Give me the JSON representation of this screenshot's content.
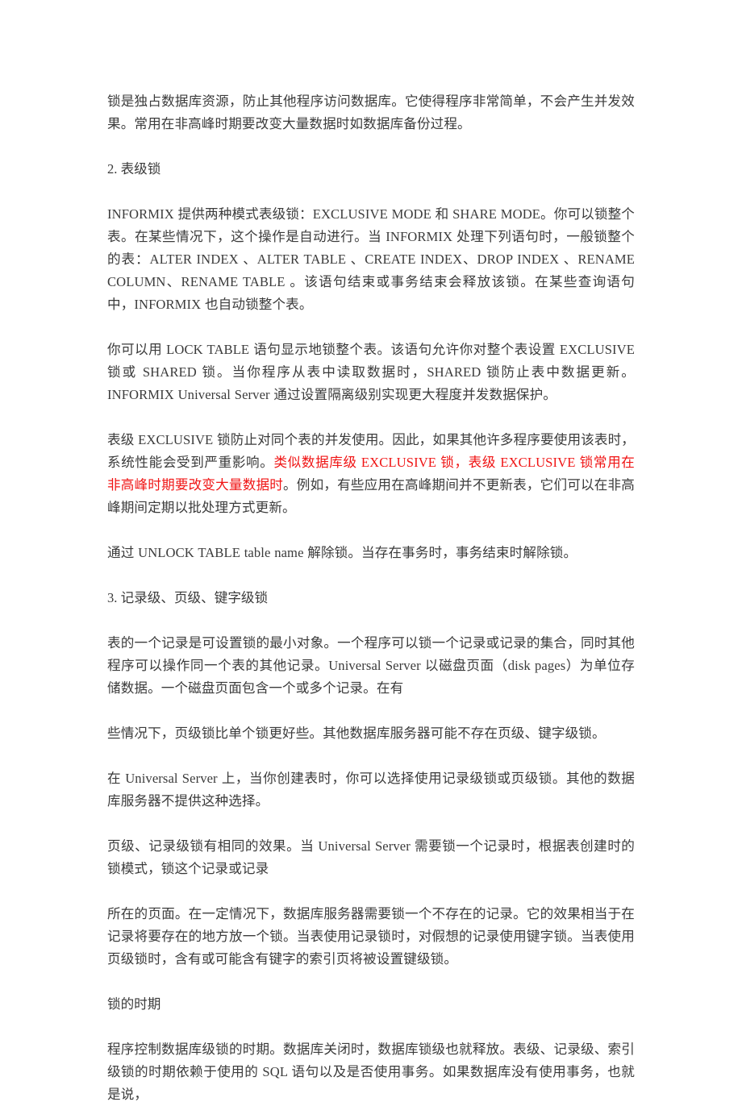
{
  "document": {
    "text_color": "#3b3b3b",
    "highlight_color": "#f01414",
    "background_color": "#ffffff",
    "blocks": [
      {
        "id": "p1",
        "type": "paragraph",
        "text": "锁是独占数据库资源，防止其他程序访问数据库。它使得程序非常简单，不会产生并发效果。常用在非高峰时期要改变大量数据时如数据库备份过程。"
      },
      {
        "id": "h2",
        "type": "heading",
        "text": "2. 表级锁"
      },
      {
        "id": "p2",
        "type": "paragraph",
        "text": "INFORMIX 提供两种模式表级锁：EXCLUSIVE MODE  和 SHARE MODE。你可以锁整个表。在某些情况下，这个操作是自动进行。当 INFORMIX 处理下列语句时，一般锁整个的表：ALTER INDEX 、ALTER TABLE 、CREATE INDEX、DROP INDEX 、RENAME COLUMN、RENAME TABLE 。该语句结束或事务结束会释放该锁。在某些查询语句中，INFORMIX 也自动锁整个表。"
      },
      {
        "id": "p3",
        "type": "paragraph",
        "text": "你可以用 LOCK TABLE 语句显示地锁整个表。该语句允许你对整个表设置 EXCLUSIVE 锁或 SHARED 锁。当你程序从表中读取数据时，SHARED 锁防止表中数据更新。INFORMIX Universal Server  通过设置隔离级别实现更大程度并发数据保护。"
      },
      {
        "id": "p4",
        "type": "paragraph-mixed",
        "text_before": "表级 EXCLUSIVE 锁防止对同个表的并发使用。因此，如果其他许多程序要使用该表时，系统性能会受到严重影响。",
        "text_highlight": "类似数据库级 EXCLUSIVE  锁，表级 EXCLUSIVE 锁常用在非高峰时期要改变大量数据时",
        "text_after": "。例如，有些应用在高峰期间并不更新表，它们可以在非高峰期间定期以批处理方式更新。"
      },
      {
        "id": "p5",
        "type": "paragraph",
        "text": "通过 UNLOCK TABLE table name  解除锁。当存在事务时，事务结束时解除锁。"
      },
      {
        "id": "h3",
        "type": "heading",
        "text": "3. 记录级、页级、键字级锁"
      },
      {
        "id": "p6",
        "type": "paragraph",
        "text": "表的一个记录是可设置锁的最小对象。一个程序可以锁一个记录或记录的集合，同时其他程序可以操作同一个表的其他记录。Universal Server  以磁盘页面（disk pages）为单位存储数据。一个磁盘页面包含一个或多个记录。在有"
      },
      {
        "id": "p7",
        "type": "paragraph",
        "text": "些情况下，页级锁比单个锁更好些。其他数据库服务器可能不存在页级、键字级锁。"
      },
      {
        "id": "p8",
        "type": "paragraph",
        "text": "在 Universal Server 上，当你创建表时，你可以选择使用记录级锁或页级锁。其他的数据库服务器不提供这种选择。"
      },
      {
        "id": "p9",
        "type": "paragraph",
        "text": "页级、记录级锁有相同的效果。当 Universal Server 需要锁一个记录时，根据表创建时的锁模式，锁这个记录或记录"
      },
      {
        "id": "p10",
        "type": "paragraph",
        "text": "所在的页面。在一定情况下，数据库服务器需要锁一个不存在的记录。它的效果相当于在记录将要存在的地方放一个锁。当表使用记录锁时，对假想的记录使用键字锁。当表使用页级锁时，含有或可能含有键字的索引页将被设置键级锁。"
      },
      {
        "id": "h4",
        "type": "heading",
        "text": "锁的时期"
      },
      {
        "id": "p11",
        "type": "paragraph",
        "text": "程序控制数据库级锁的时期。数据库关闭时，数据库锁级也就释放。表级、记录级、索引级锁的时期依赖于使用的 SQL  语句以及是否使用事务。如果数据库没有使用事务，也就是说，"
      }
    ]
  }
}
